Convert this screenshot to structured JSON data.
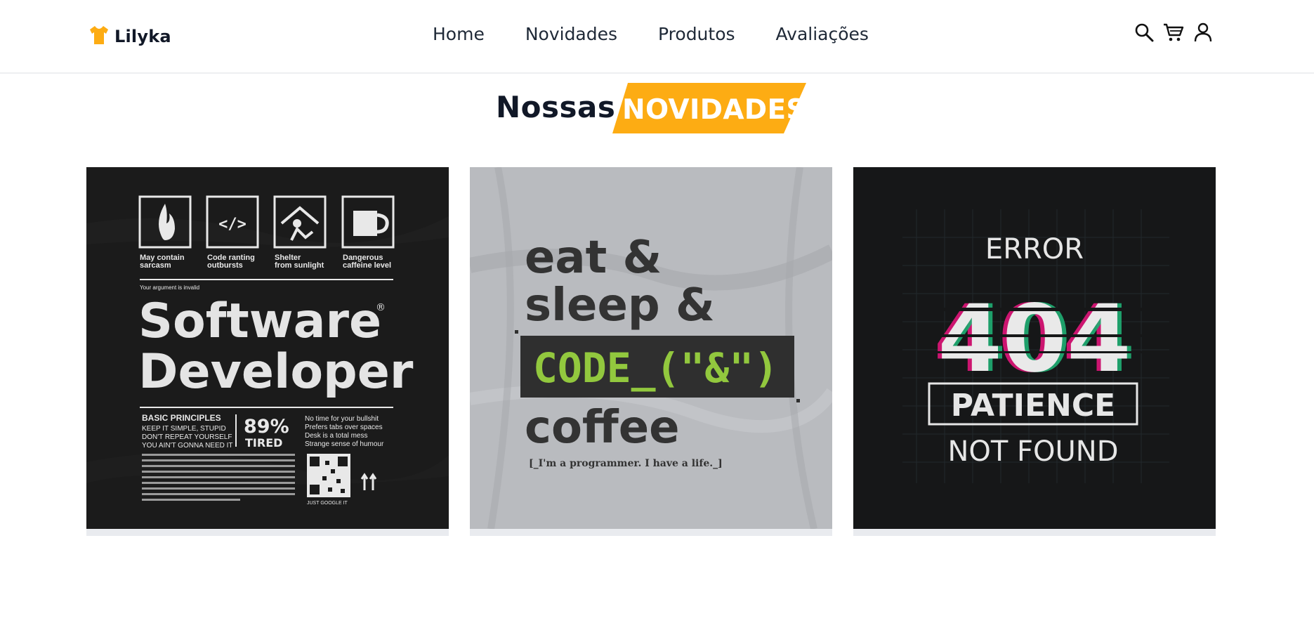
{
  "header": {
    "logo": {
      "icon": "tshirt-icon",
      "text": "Lilyka",
      "color": "#fdac13"
    },
    "nav": [
      {
        "label": "Home"
      },
      {
        "label": "Novidades"
      },
      {
        "label": "Produtos"
      },
      {
        "label": "Avaliações"
      }
    ],
    "actions": [
      {
        "icon": "search-icon"
      },
      {
        "icon": "cart-icon"
      },
      {
        "icon": "user-icon"
      }
    ]
  },
  "section": {
    "title_plain": "Nossas",
    "title_highlight": "NOVIDADES",
    "accent": "#fdac13"
  },
  "products": [
    {
      "shirt_color": "#1b1b1b",
      "design": {
        "badges": [
          {
            "line1": "May contain",
            "line2": "sarcasm"
          },
          {
            "line1": "Code ranting",
            "line2": "outbursts"
          },
          {
            "line1": "Shelter",
            "line2": "from sunlight"
          },
          {
            "line1": "Dangerous",
            "line2": "caffeine level"
          }
        ],
        "small_top": "Your argument is invalid",
        "main_line1": "Software",
        "main_line2": "Developer",
        "principles_title": "BASIC PRINCIPLES",
        "principles": [
          "KEEP IT SIMPLE, STUPID",
          "DON'T REPEAT YOURSELF",
          "YOU AIN'T GONNA NEED IT"
        ],
        "stat_value": "89%",
        "stat_label": "TIRED",
        "facts": [
          "No time for your bullshit",
          "Prefers tabs over spaces",
          "Desk is a total mess",
          "Strange sense of humour"
        ],
        "qr_caption": "JUST GOOGLE IT"
      }
    },
    {
      "shirt_color": "#b9bbbf",
      "design": {
        "line1": "eat &",
        "line2": "sleep &",
        "code_line": "CODE_(\"&\")",
        "line4": "coffee",
        "caption": "[_I'm a programmer. I have a life._]"
      }
    },
    {
      "shirt_color": "#161718",
      "design": {
        "top": "ERROR",
        "big": "404",
        "boxed": "PATIENCE",
        "bottom": "NOT FOUND"
      }
    }
  ]
}
